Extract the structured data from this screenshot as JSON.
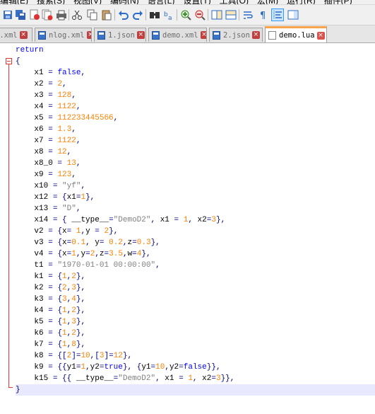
{
  "menu": [
    "编辑(E)",
    "搜索(S)",
    "视图(V)",
    "编码(N)",
    "语言(L)",
    "设置(T)",
    "工具(O)",
    "宏(M)",
    "运行(R)",
    "插件(P)"
  ],
  "toolbar_icons": [
    "save-icon",
    "save-all-icon",
    "close-icon",
    "close-all-icon",
    "print-icon",
    "cut-icon",
    "copy-icon",
    "paste-icon",
    "undo-icon",
    "redo-icon",
    "find-icon",
    "replace-icon",
    "zoom-in-icon",
    "zoom-out-icon",
    "sync-vertical-icon",
    "sync-horizontal-icon",
    "word-wrap-icon",
    "show-all-chars-icon",
    "indent-guide-icon",
    "document-map-icon"
  ],
  "tabs": [
    {
      "label": "m.xml",
      "active": false,
      "kind": "blue"
    },
    {
      "label": "nlog.xml",
      "active": false,
      "kind": "blue"
    },
    {
      "label": "1.json",
      "active": false,
      "kind": "blue"
    },
    {
      "label": "demo.xml",
      "active": false,
      "kind": "blue"
    },
    {
      "label": "2.json",
      "active": false,
      "kind": "blue"
    },
    {
      "label": "demo.lua",
      "active": true,
      "kind": "white"
    }
  ],
  "code_lines": [
    [
      [
        "kw",
        "return"
      ]
    ],
    [
      [
        "op",
        "{"
      ]
    ],
    [
      [
        "t",
        "    x1 "
      ],
      [
        "op",
        "="
      ],
      [
        "t",
        " "
      ],
      [
        "kw",
        "false"
      ],
      [
        "op",
        ","
      ]
    ],
    [
      [
        "t",
        "    x2 "
      ],
      [
        "op",
        "="
      ],
      [
        "t",
        " "
      ],
      [
        "num",
        "2"
      ],
      [
        "op",
        ","
      ]
    ],
    [
      [
        "t",
        "    x3 "
      ],
      [
        "op",
        "="
      ],
      [
        "t",
        " "
      ],
      [
        "num",
        "128"
      ],
      [
        "op",
        ","
      ]
    ],
    [
      [
        "t",
        "    x4 "
      ],
      [
        "op",
        "="
      ],
      [
        "t",
        " "
      ],
      [
        "num",
        "1122"
      ],
      [
        "op",
        ","
      ]
    ],
    [
      [
        "t",
        "    x5 "
      ],
      [
        "op",
        "="
      ],
      [
        "t",
        " "
      ],
      [
        "num",
        "112233445566"
      ],
      [
        "op",
        ","
      ]
    ],
    [
      [
        "t",
        "    x6 "
      ],
      [
        "op",
        "="
      ],
      [
        "t",
        " "
      ],
      [
        "num",
        "1.3"
      ],
      [
        "op",
        ","
      ]
    ],
    [
      [
        "t",
        "    x7 "
      ],
      [
        "op",
        "="
      ],
      [
        "t",
        " "
      ],
      [
        "num",
        "1122"
      ],
      [
        "op",
        ","
      ]
    ],
    [
      [
        "t",
        "    x8 "
      ],
      [
        "op",
        "="
      ],
      [
        "t",
        " "
      ],
      [
        "num",
        "12"
      ],
      [
        "op",
        ","
      ]
    ],
    [
      [
        "t",
        "    x8_0 "
      ],
      [
        "op",
        "="
      ],
      [
        "t",
        " "
      ],
      [
        "num",
        "13"
      ],
      [
        "op",
        ","
      ]
    ],
    [
      [
        "t",
        "    x9 "
      ],
      [
        "op",
        "="
      ],
      [
        "t",
        " "
      ],
      [
        "num",
        "123"
      ],
      [
        "op",
        ","
      ]
    ],
    [
      [
        "t",
        "    x10 "
      ],
      [
        "op",
        "="
      ],
      [
        "t",
        " "
      ],
      [
        "str",
        "\"yf\""
      ],
      [
        "op",
        ","
      ]
    ],
    [
      [
        "t",
        "    x12 "
      ],
      [
        "op",
        "="
      ],
      [
        "t",
        " "
      ],
      [
        "op",
        "{"
      ],
      [
        "t",
        "x1"
      ],
      [
        "op",
        "="
      ],
      [
        "num",
        "1"
      ],
      [
        "op",
        "},"
      ]
    ],
    [
      [
        "t",
        "    x13 "
      ],
      [
        "op",
        "="
      ],
      [
        "t",
        " "
      ],
      [
        "str",
        "\"D\""
      ],
      [
        "op",
        ","
      ]
    ],
    [
      [
        "t",
        "    x14 "
      ],
      [
        "op",
        "="
      ],
      [
        "t",
        " "
      ],
      [
        "op",
        "{"
      ],
      [
        "t",
        " __type__"
      ],
      [
        "op",
        "="
      ],
      [
        "str",
        "\"DemoD2\""
      ],
      [
        "op",
        ","
      ],
      [
        "t",
        " x1 "
      ],
      [
        "op",
        "="
      ],
      [
        "t",
        " "
      ],
      [
        "num",
        "1"
      ],
      [
        "op",
        ","
      ],
      [
        "t",
        " x2"
      ],
      [
        "op",
        "="
      ],
      [
        "num",
        "3"
      ],
      [
        "op",
        "},"
      ]
    ],
    [
      [
        "t",
        "    v2 "
      ],
      [
        "op",
        "="
      ],
      [
        "t",
        " "
      ],
      [
        "op",
        "{"
      ],
      [
        "t",
        "x"
      ],
      [
        "op",
        "="
      ],
      [
        "t",
        " "
      ],
      [
        "num",
        "1"
      ],
      [
        "op",
        ","
      ],
      [
        "t",
        "y "
      ],
      [
        "op",
        "="
      ],
      [
        "t",
        " "
      ],
      [
        "num",
        "2"
      ],
      [
        "op",
        "},"
      ]
    ],
    [
      [
        "t",
        "    v3 "
      ],
      [
        "op",
        "="
      ],
      [
        "t",
        " "
      ],
      [
        "op",
        "{"
      ],
      [
        "t",
        "x"
      ],
      [
        "op",
        "="
      ],
      [
        "num",
        "0.1"
      ],
      [
        "op",
        ","
      ],
      [
        "t",
        " y"
      ],
      [
        "op",
        "="
      ],
      [
        "t",
        " "
      ],
      [
        "num",
        "0.2"
      ],
      [
        "op",
        ","
      ],
      [
        "t",
        "z"
      ],
      [
        "op",
        "="
      ],
      [
        "num",
        "0.3"
      ],
      [
        "op",
        "},"
      ]
    ],
    [
      [
        "t",
        "    v4 "
      ],
      [
        "op",
        "="
      ],
      [
        "t",
        " "
      ],
      [
        "op",
        "{"
      ],
      [
        "t",
        "x"
      ],
      [
        "op",
        "="
      ],
      [
        "num",
        "1"
      ],
      [
        "op",
        ","
      ],
      [
        "t",
        "y"
      ],
      [
        "op",
        "="
      ],
      [
        "num",
        "2"
      ],
      [
        "op",
        ","
      ],
      [
        "t",
        "z"
      ],
      [
        "op",
        "="
      ],
      [
        "num",
        "3.5"
      ],
      [
        "op",
        ","
      ],
      [
        "t",
        "w"
      ],
      [
        "op",
        "="
      ],
      [
        "num",
        "4"
      ],
      [
        "op",
        "},"
      ]
    ],
    [
      [
        "t",
        "    t1 "
      ],
      [
        "op",
        "="
      ],
      [
        "t",
        " "
      ],
      [
        "str",
        "\"1970-01-01 00:00:00\""
      ],
      [
        "op",
        ","
      ]
    ],
    [
      [
        "t",
        "    k1 "
      ],
      [
        "op",
        "="
      ],
      [
        "t",
        " "
      ],
      [
        "op",
        "{"
      ],
      [
        "num",
        "1"
      ],
      [
        "op",
        ","
      ],
      [
        "num",
        "2"
      ],
      [
        "op",
        "},"
      ]
    ],
    [
      [
        "t",
        "    k2 "
      ],
      [
        "op",
        "="
      ],
      [
        "t",
        " "
      ],
      [
        "op",
        "{"
      ],
      [
        "num",
        "2"
      ],
      [
        "op",
        ","
      ],
      [
        "num",
        "3"
      ],
      [
        "op",
        "},"
      ]
    ],
    [
      [
        "t",
        "    k3 "
      ],
      [
        "op",
        "="
      ],
      [
        "t",
        " "
      ],
      [
        "op",
        "{"
      ],
      [
        "num",
        "3"
      ],
      [
        "op",
        ","
      ],
      [
        "num",
        "4"
      ],
      [
        "op",
        "},"
      ]
    ],
    [
      [
        "t",
        "    k4 "
      ],
      [
        "op",
        "="
      ],
      [
        "t",
        " "
      ],
      [
        "op",
        "{"
      ],
      [
        "num",
        "1"
      ],
      [
        "op",
        ","
      ],
      [
        "num",
        "2"
      ],
      [
        "op",
        "},"
      ]
    ],
    [
      [
        "t",
        "    k5 "
      ],
      [
        "op",
        "="
      ],
      [
        "t",
        " "
      ],
      [
        "op",
        "{"
      ],
      [
        "num",
        "1"
      ],
      [
        "op",
        ","
      ],
      [
        "num",
        "3"
      ],
      [
        "op",
        "},"
      ]
    ],
    [
      [
        "t",
        "    k6 "
      ],
      [
        "op",
        "="
      ],
      [
        "t",
        " "
      ],
      [
        "op",
        "{"
      ],
      [
        "num",
        "1"
      ],
      [
        "op",
        ","
      ],
      [
        "num",
        "2"
      ],
      [
        "op",
        "},"
      ]
    ],
    [
      [
        "t",
        "    k7 "
      ],
      [
        "op",
        "="
      ],
      [
        "t",
        " "
      ],
      [
        "op",
        "{"
      ],
      [
        "num",
        "1"
      ],
      [
        "op",
        ","
      ],
      [
        "num",
        "8"
      ],
      [
        "op",
        "},"
      ]
    ],
    [
      [
        "t",
        "    k8 "
      ],
      [
        "op",
        "="
      ],
      [
        "t",
        " "
      ],
      [
        "op",
        "{["
      ],
      [
        "num",
        "2"
      ],
      [
        "op",
        "]="
      ],
      [
        "num",
        "10"
      ],
      [
        "op",
        ",["
      ],
      [
        "num",
        "3"
      ],
      [
        "op",
        "]="
      ],
      [
        "num",
        "12"
      ],
      [
        "op",
        "},"
      ]
    ],
    [
      [
        "t",
        "    k9 "
      ],
      [
        "op",
        "="
      ],
      [
        "t",
        " "
      ],
      [
        "op",
        "{{"
      ],
      [
        "t",
        "y1"
      ],
      [
        "op",
        "="
      ],
      [
        "num",
        "1"
      ],
      [
        "op",
        ","
      ],
      [
        "t",
        "y2"
      ],
      [
        "op",
        "="
      ],
      [
        "kw",
        "true"
      ],
      [
        "op",
        "},"
      ],
      [
        "t",
        " "
      ],
      [
        "op",
        "{"
      ],
      [
        "t",
        "y1"
      ],
      [
        "op",
        "="
      ],
      [
        "num",
        "10"
      ],
      [
        "op",
        ","
      ],
      [
        "t",
        "y2"
      ],
      [
        "op",
        "="
      ],
      [
        "kw",
        "false"
      ],
      [
        "op",
        "}},"
      ]
    ],
    [
      [
        "t",
        "    k15 "
      ],
      [
        "op",
        "="
      ],
      [
        "t",
        " "
      ],
      [
        "op",
        "{{"
      ],
      [
        "t",
        " __type__"
      ],
      [
        "op",
        "="
      ],
      [
        "str",
        "\"DemoD2\""
      ],
      [
        "op",
        ","
      ],
      [
        "t",
        " x1 "
      ],
      [
        "op",
        "="
      ],
      [
        "t",
        " "
      ],
      [
        "num",
        "1"
      ],
      [
        "op",
        ","
      ],
      [
        "t",
        " x2"
      ],
      [
        "op",
        "="
      ],
      [
        "num",
        "3"
      ],
      [
        "op",
        "}},"
      ]
    ],
    [
      [
        "op",
        "}"
      ]
    ]
  ],
  "current_line": 31
}
